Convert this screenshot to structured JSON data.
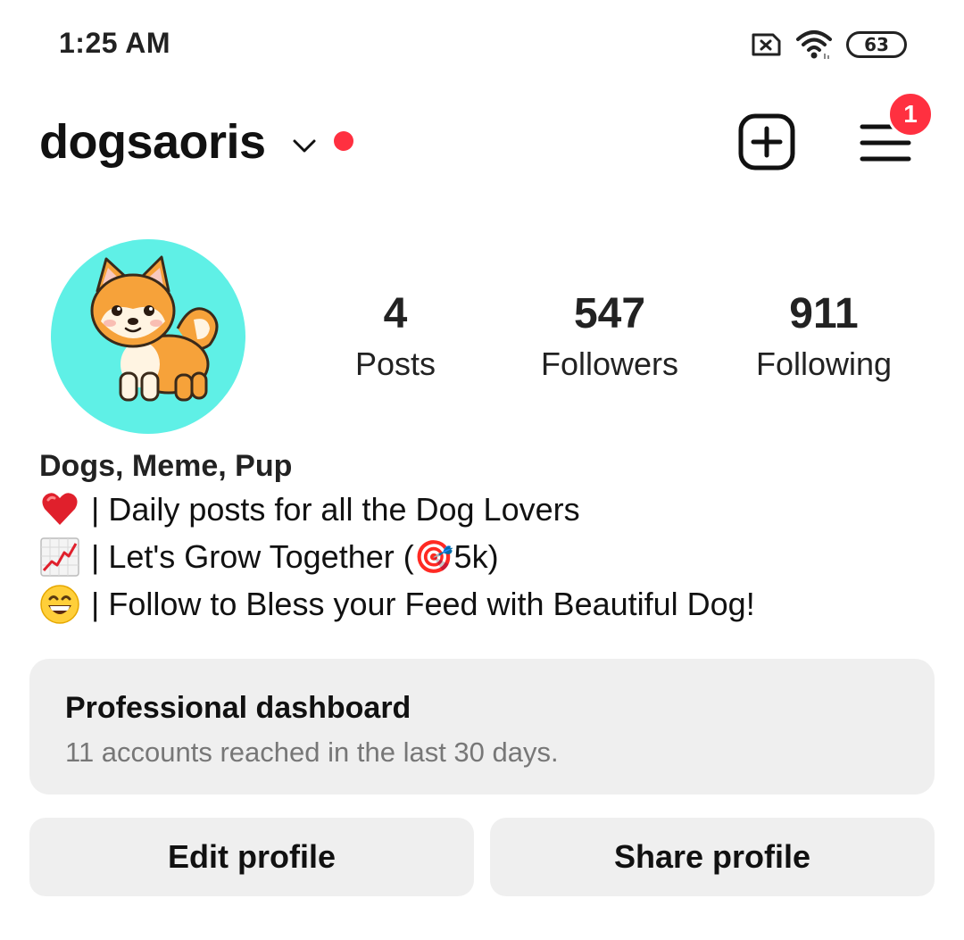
{
  "status_bar": {
    "time": "1:25 AM",
    "battery": "63",
    "icons": [
      "sim-off-icon",
      "wifi-icon",
      "battery-icon"
    ]
  },
  "header": {
    "username": "dogsaoris",
    "menu_badge": "1",
    "accent_color": "#ff3040"
  },
  "stats": [
    {
      "value": "4",
      "label": "Posts"
    },
    {
      "value": "547",
      "label": "Followers"
    },
    {
      "value": "911",
      "label": "Following"
    }
  ],
  "bio": {
    "name": "Dogs, Meme, Pup",
    "lines": [
      {
        "icon": "heart-emoji",
        "text": "| Daily posts for all the Dog Lovers"
      },
      {
        "icon": "chart-increasing-emoji",
        "text": "| Let's Grow Together (🎯5k)"
      },
      {
        "icon": "grinning-face-emoji",
        "text": "| Follow to Bless your Feed with Beautiful Dog!"
      }
    ]
  },
  "dashboard": {
    "title": "Professional dashboard",
    "subtitle": "11 accounts reached in the last 30 days."
  },
  "buttons": {
    "edit": "Edit profile",
    "share": "Share profile"
  }
}
